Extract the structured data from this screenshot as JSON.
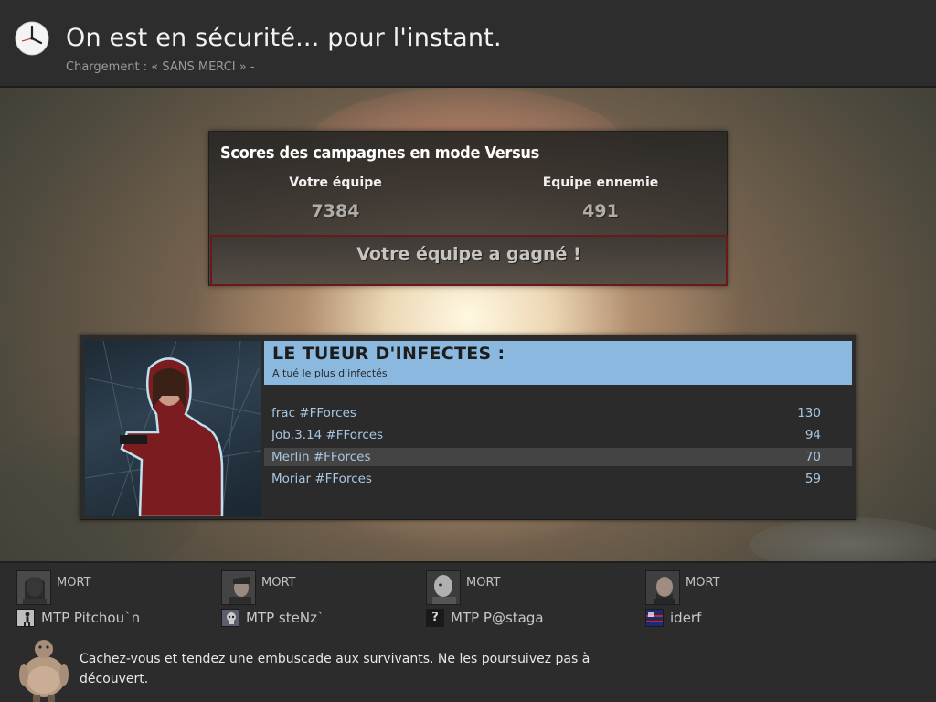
{
  "header": {
    "title": "On est en sécurité... pour l'instant.",
    "subtitle": "Chargement : « SANS MERCI » -"
  },
  "versus": {
    "title": "Scores des campagnes en mode Versus",
    "team_label": "Votre équipe",
    "team_score": "7384",
    "enemy_label": "Equipe ennemie",
    "enemy_score": "491",
    "result": "Votre équipe a gagné !"
  },
  "award": {
    "title": "LE TUEUR D'INFECTES :",
    "description": "A tué le plus d'infectés",
    "rows": [
      {
        "name": "frac #FForces",
        "value": "130"
      },
      {
        "name": "Job.3.14 #FForces",
        "value": "94"
      },
      {
        "name": "Merlin #FForces",
        "value": "70"
      },
      {
        "name": "Moriar #FForces",
        "value": "59"
      }
    ],
    "highlighted_row": 2,
    "header_color": "#8ab8df"
  },
  "players": [
    {
      "status": "MORT",
      "name": "MTP Pitchou`n",
      "icon": "person-spray-icon"
    },
    {
      "status": "MORT",
      "name": "MTP steNz`",
      "icon": "skull-spray-icon"
    },
    {
      "status": "MORT",
      "name": "MTP P@staga",
      "icon": "question-mark-icon"
    },
    {
      "status": "MORT",
      "name": "iderf",
      "icon": "flag-icon"
    }
  ],
  "tip": {
    "text": "Cachez-vous et tendez une embuscade aux survivants. Ne les poursuivez pas à découvert.",
    "icon": "boomer-icon"
  },
  "question_mark": "?"
}
